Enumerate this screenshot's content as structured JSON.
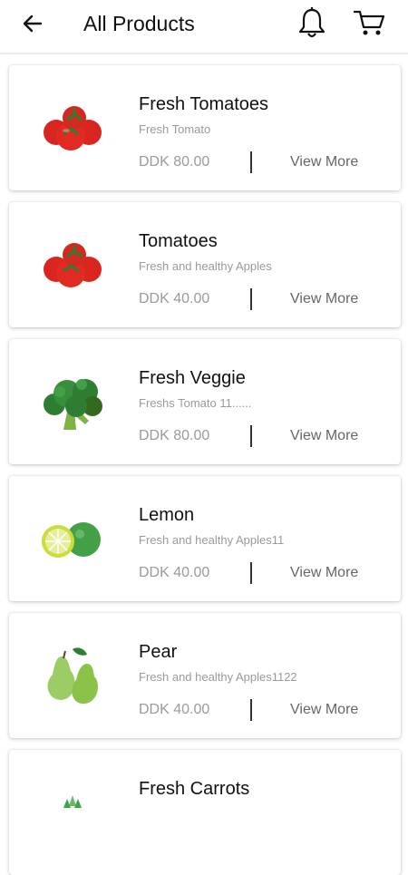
{
  "header": {
    "title": "All Products",
    "icons": [
      "arrow-back-icon",
      "bell-icon",
      "cart-icon"
    ]
  },
  "products": [
    {
      "name": "Fresh Tomatoes",
      "desc": "Fresh Tomato",
      "price": "DDK 80.00",
      "action": "View More",
      "image": "tomato-image"
    },
    {
      "name": "Tomatoes",
      "desc": "Fresh and healthy Apples",
      "price": "DDK 40.00",
      "action": "View More",
      "image": "tomato-image"
    },
    {
      "name": "Fresh Veggie",
      "desc": "Freshs Tomato 11......",
      "price": "DDK 80.00",
      "action": "View More",
      "image": "broccoli-image"
    },
    {
      "name": "Lemon",
      "desc": "Fresh and healthy Apples11",
      "price": "DDK 40.00",
      "action": "View More",
      "image": "lime-image"
    },
    {
      "name": "Pear",
      "desc": "Fresh and healthy Apples1122",
      "price": "DDK 40.00",
      "action": "View More",
      "image": "pear-image"
    },
    {
      "name": "Fresh Carrots",
      "desc": "",
      "price": "",
      "action": "",
      "image": "carrot-image"
    }
  ],
  "colors": {
    "muted_text": "#9a9a9a",
    "title_text": "#111111",
    "card_bg": "#ffffff"
  }
}
